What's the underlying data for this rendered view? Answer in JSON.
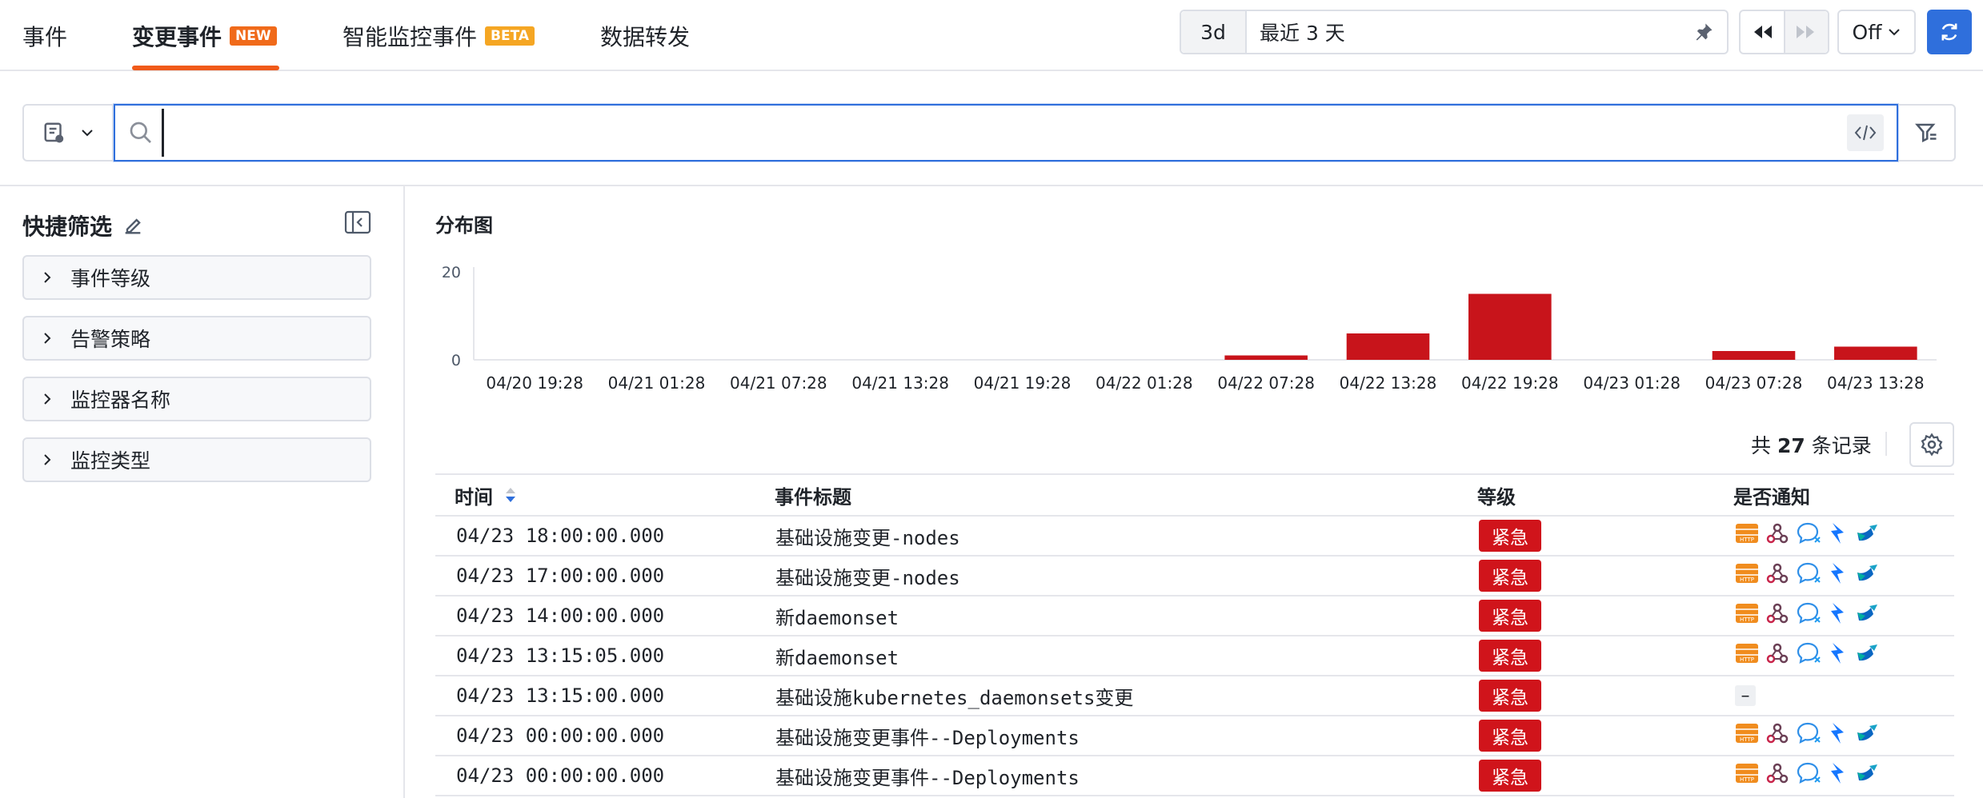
{
  "tabs": [
    {
      "label": "事件",
      "badge": ""
    },
    {
      "label": "变更事件",
      "badge": "NEW"
    },
    {
      "label": "智能监控事件",
      "badge": "BETA"
    },
    {
      "label": "数据转发",
      "badge": ""
    }
  ],
  "time": {
    "short": "3d",
    "label": "最近 3 天",
    "refresh_mode": "Off"
  },
  "search": {
    "placeholder": "",
    "value": ""
  },
  "quick_filter": {
    "title": "快捷筛选",
    "items": [
      "事件等级",
      "告警策略",
      "监控器名称",
      "监控类型"
    ]
  },
  "chart_title": "分布图",
  "chart_data": {
    "type": "bar",
    "categories": [
      "04/20 19:28",
      "04/21 01:28",
      "04/21 07:28",
      "04/21 13:28",
      "04/21 19:28",
      "04/22 01:28",
      "04/22 07:28",
      "04/22 13:28",
      "04/22 19:28",
      "04/23 01:28",
      "04/23 07:28",
      "04/23 13:28"
    ],
    "values": [
      0,
      0,
      0,
      0,
      0,
      0,
      1,
      6,
      15,
      0,
      2,
      3
    ],
    "ylim": [
      0,
      20
    ],
    "yticks": [
      0,
      20
    ],
    "color": "#c8141b"
  },
  "total": {
    "prefix": "共",
    "count": "27",
    "suffix": "条记录"
  },
  "table": {
    "headers": {
      "time": "时间",
      "title": "事件标题",
      "level": "等级",
      "notify": "是否通知"
    },
    "rows": [
      {
        "time": "04/23 18:00:00.000",
        "title": "基础设施变更-nodes",
        "level": "紧急",
        "notify": true
      },
      {
        "time": "04/23 17:00:00.000",
        "title": "基础设施变更-nodes",
        "level": "紧急",
        "notify": true
      },
      {
        "time": "04/23 14:00:00.000",
        "title": "新daemonset",
        "level": "紧急",
        "notify": true
      },
      {
        "time": "04/23 13:15:05.000",
        "title": "新daemonset",
        "level": "紧急",
        "notify": true
      },
      {
        "time": "04/23 13:15:00.000",
        "title": "基础设施kubernetes_daemonsets变更",
        "level": "紧急",
        "notify": false,
        "notify_text": "–"
      },
      {
        "time": "04/23 00:00:00.000",
        "title": "基础设施变更事件--Deployments",
        "level": "紧急",
        "notify": true
      },
      {
        "time": "04/23 00:00:00.000",
        "title": "基础设施变更事件--Deployments",
        "level": "紧急",
        "notify": true
      }
    ]
  },
  "notify_icons": [
    "http-icon",
    "webhook-icon",
    "chat-bubble-icon",
    "feishu-icon",
    "dingtalk-icon"
  ],
  "colors": {
    "accent": "#2f6fdc",
    "tab_active": "#f05a1a",
    "urgent": "#d0141b"
  }
}
